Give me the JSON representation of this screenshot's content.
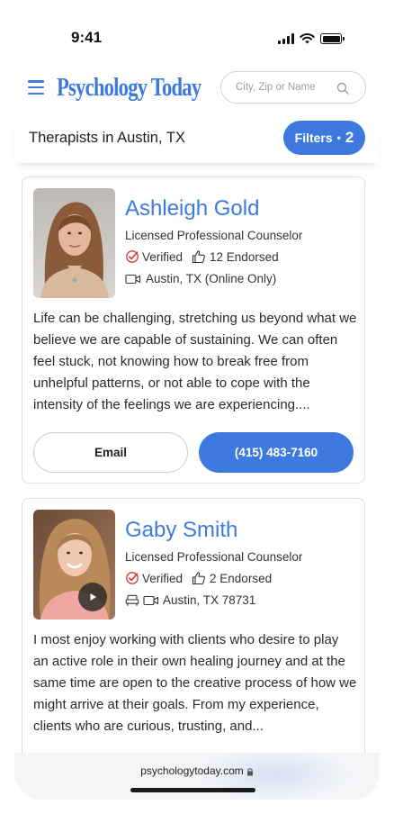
{
  "status": {
    "time": "9:41",
    "icons": [
      "signal-icon",
      "wifi-icon",
      "battery-icon"
    ]
  },
  "header": {
    "logo": "Psychology Today",
    "search_placeholder": "City, Zip or Name",
    "icons": [
      "menu-icon",
      "search-icon"
    ]
  },
  "title_bar": {
    "title": "Therapists in Austin, TX",
    "filters_label": "Filters",
    "filters_separator": "•",
    "filters_count": "2"
  },
  "therapists": [
    {
      "name": "Ashleigh Gold",
      "credential": "Licensed Professional Counselor",
      "verified": "Verified",
      "endorsed": "12 Endorsed",
      "location": "Austin, TX (Online Only)",
      "bio": "Life can be challenging, stretching us beyond what we believe we are capable of sustaining. We can often feel stuck, not knowing how to break free from unhelpful patterns, or not able to cope with the intensity of the feelings we are experiencing....",
      "email_label": "Email",
      "phone_label": "(415) 483-7160"
    },
    {
      "name": "Gaby Smith",
      "credential": "Licensed Professional Counselor",
      "verified": "Verified",
      "endorsed": "2 Endorsed",
      "location": "Austin, TX 78731",
      "bio": "I most enjoy working with clients who desire to play an active role in their own healing journey and at the same time are open to the creative process of how we might arrive at their goals. From my experience, clients who are curious, trusting, and..."
    }
  ],
  "browser": {
    "url": "psychologytoday.com"
  },
  "colors": {
    "accent": "#3e79e0",
    "text": "#1f1f1f",
    "border": "#dcdfe3",
    "verified_red": "#d9342b"
  }
}
